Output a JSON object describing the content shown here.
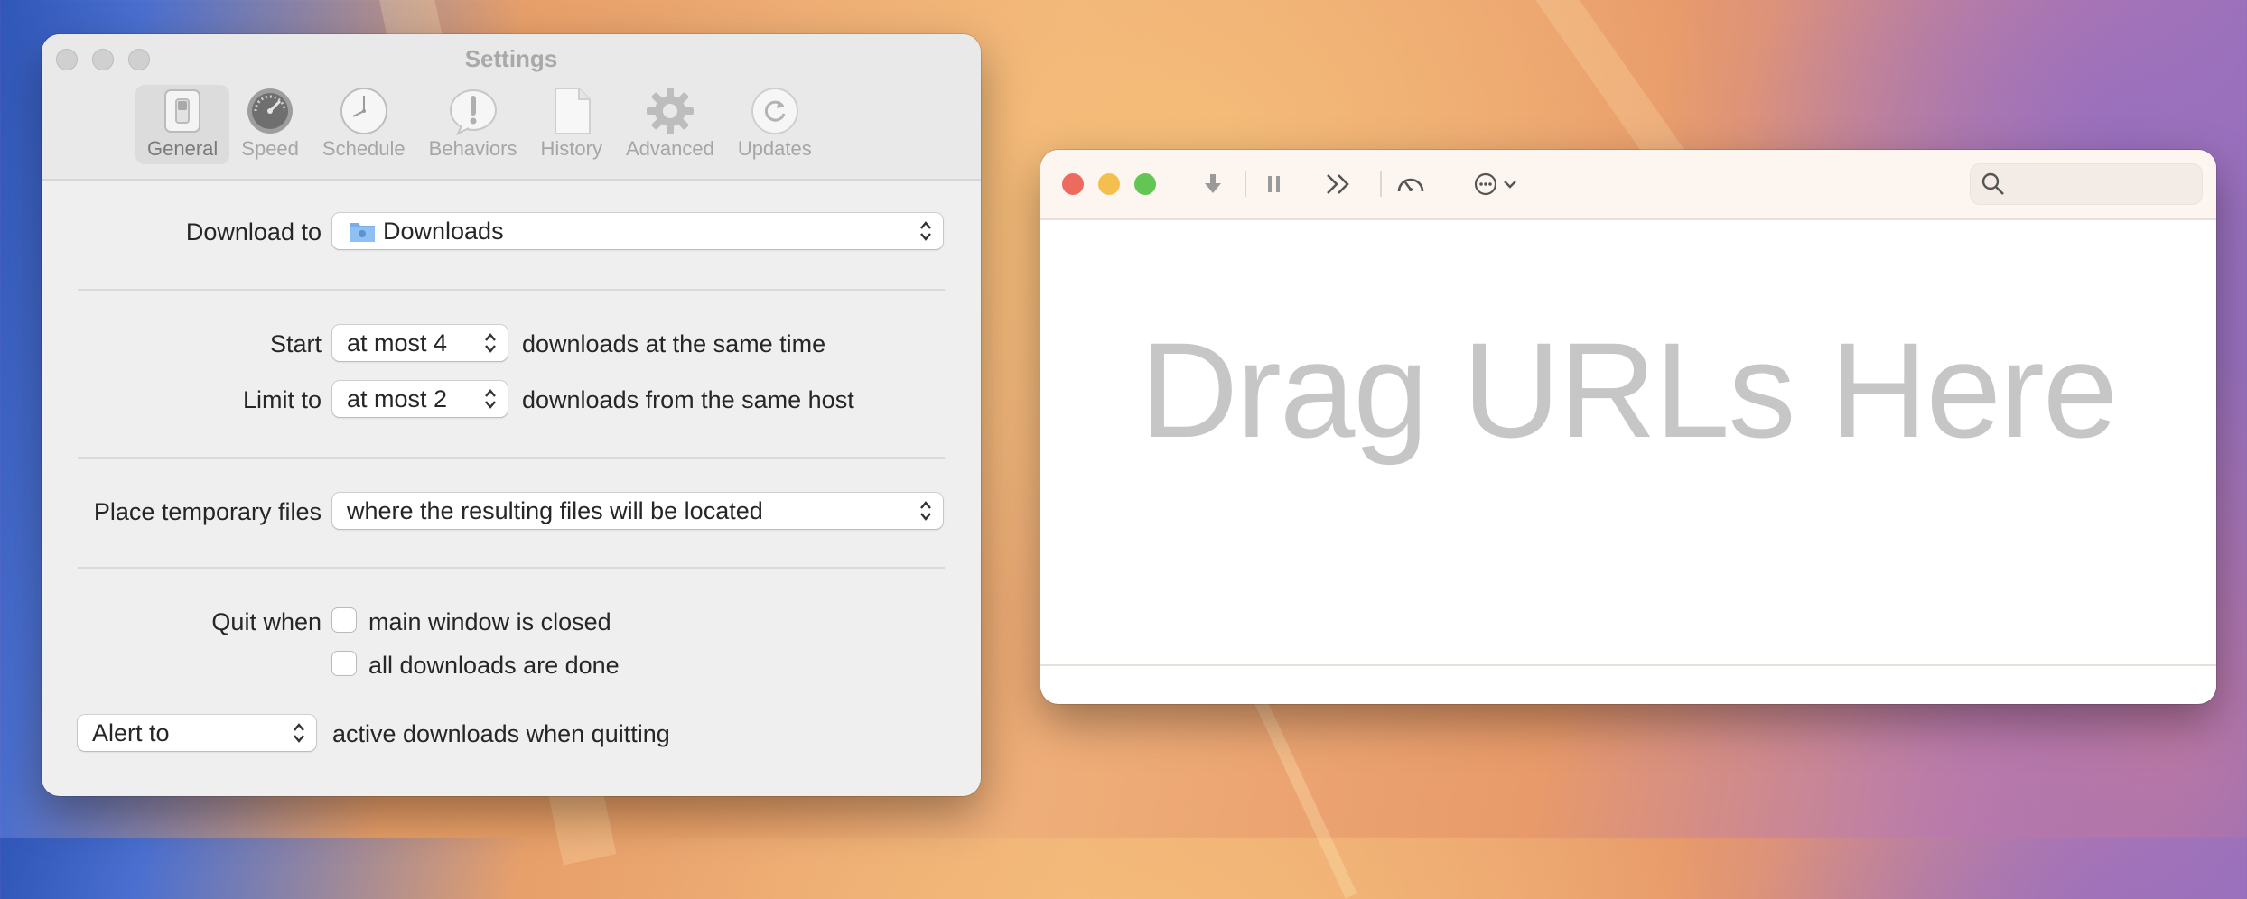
{
  "settings": {
    "title": "Settings",
    "tabs": [
      {
        "label": "General",
        "icon": "switch-icon"
      },
      {
        "label": "Speed",
        "icon": "speedometer-icon"
      },
      {
        "label": "Schedule",
        "icon": "clock-icon"
      },
      {
        "label": "Behaviors",
        "icon": "exclamation-icon"
      },
      {
        "label": "History",
        "icon": "document-icon"
      },
      {
        "label": "Advanced",
        "icon": "gear-icon"
      },
      {
        "label": "Updates",
        "icon": "refresh-icon"
      }
    ],
    "download_to": {
      "label": "Download to",
      "value": "Downloads",
      "icon": "folder-icon"
    },
    "start": {
      "label": "Start",
      "value": "at most 4",
      "after": "downloads at the same time"
    },
    "limit": {
      "label": "Limit to",
      "value": "at most 2",
      "after": "downloads from the same host"
    },
    "temp": {
      "label": "Place temporary files",
      "value": "where the resulting files will be located"
    },
    "quit": {
      "label": "Quit when",
      "option1": "main window is closed",
      "option2": "all downloads are done"
    },
    "alert": {
      "value": "Alert to",
      "after": "active downloads when quitting"
    }
  },
  "main": {
    "drop_text": "Drag URLs Here",
    "toolbar_icons": [
      "download-icon",
      "pause-icon",
      "skip-forward-icon",
      "speedometer-icon",
      "more-icon",
      "chevron-down-icon"
    ],
    "search": {
      "placeholder": ""
    }
  },
  "colors": {
    "close": "#ed6a5e",
    "minimize": "#f5bf4f",
    "zoom": "#62c554"
  }
}
